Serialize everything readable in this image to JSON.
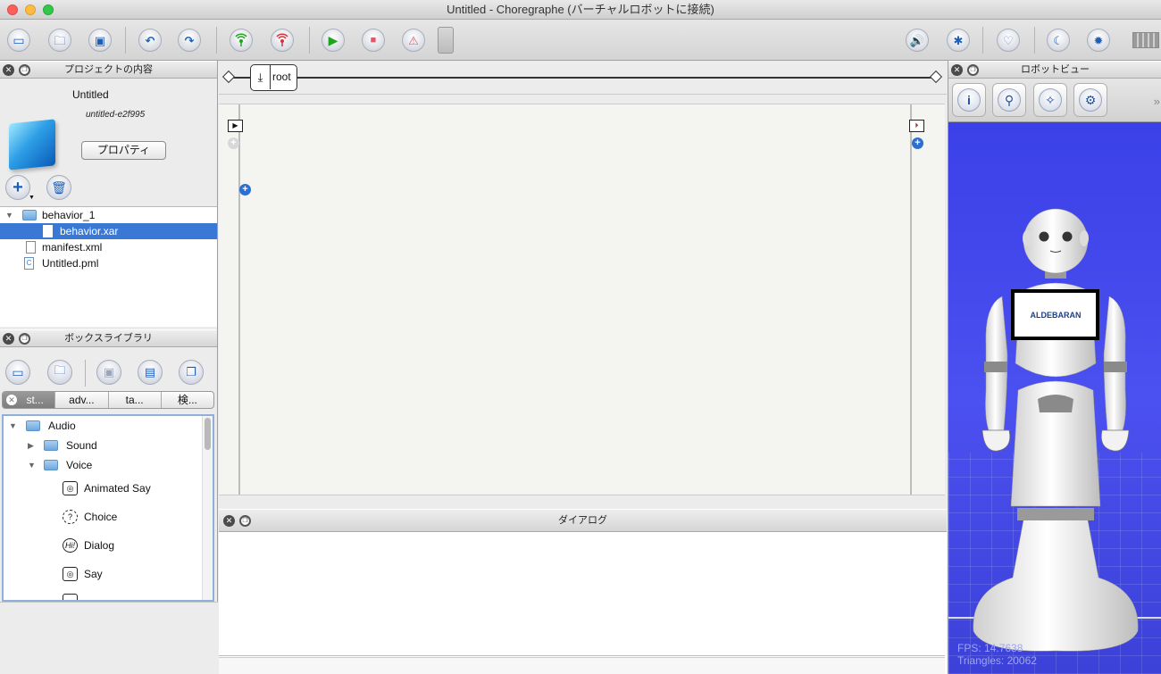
{
  "window": {
    "title": "Untitled - Choregraphe (バーチャルロボットに接続)"
  },
  "toolbar": {
    "buttons": [
      {
        "name": "new-project-icon",
        "glyph": "▭"
      },
      {
        "name": "open-project-icon",
        "glyph": "⌂"
      },
      {
        "name": "save-project-icon",
        "glyph": "▣"
      },
      {
        "name": "undo-icon",
        "glyph": "↶"
      },
      {
        "name": "redo-icon",
        "glyph": "↷"
      },
      {
        "name": "connect-icon",
        "glyph": "📶"
      },
      {
        "name": "disconnect-icon",
        "glyph": "📶"
      },
      {
        "name": "play-icon",
        "glyph": "▶"
      },
      {
        "name": "stop-icon",
        "glyph": "■"
      },
      {
        "name": "debug-icon",
        "glyph": "⚠"
      }
    ]
  },
  "project_panel": {
    "title": "プロジェクトの内容",
    "project_name": "Untitled",
    "project_id": "untitled-e2f995",
    "properties_label": "プロパティ",
    "files": [
      {
        "label": "behavior_1",
        "type": "folder"
      },
      {
        "label": "behavior.xar",
        "type": "file",
        "selected": true
      },
      {
        "label": "manifest.xml",
        "type": "file"
      },
      {
        "label": "Untitled.pml",
        "type": "pml"
      }
    ]
  },
  "box_library": {
    "title": "ボックスライブラリ",
    "tabs": [
      "st...",
      "adv...",
      "ta...",
      "検..."
    ],
    "items": [
      {
        "label": "Audio",
        "kind": "folder"
      },
      {
        "label": "Sound",
        "kind": "folder"
      },
      {
        "label": "Voice",
        "kind": "folder"
      },
      {
        "label": "Animated Say",
        "kind": "box",
        "icon": "speech-bubble-icon"
      },
      {
        "label": "Choice",
        "kind": "box",
        "icon": "question-icon"
      },
      {
        "label": "Dialog",
        "kind": "box",
        "icon": "hi-bubble-icon"
      },
      {
        "label": "Say",
        "kind": "box",
        "icon": "speech-bubble-icon"
      }
    ]
  },
  "flow": {
    "root_label": "root"
  },
  "dialog_panel": {
    "title": "ダイアログ"
  },
  "robot_view": {
    "title": "ロボットビュー",
    "chest_logo": "ALDEBARAN",
    "fps_text": "FPS: 14.7638",
    "triangles_text": "Triangles: 20062"
  },
  "colors": {
    "selection": "#3a78d6",
    "viewport": "#4448ea",
    "accent": "#2d6fd0"
  }
}
